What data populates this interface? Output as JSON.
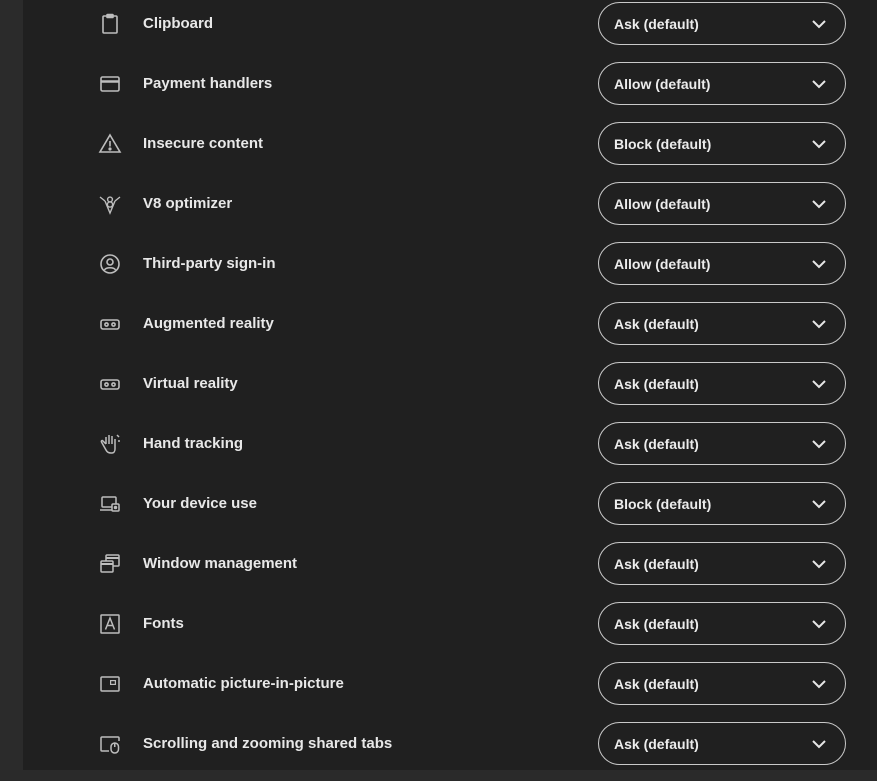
{
  "permissions": [
    {
      "label": "Clipboard",
      "value": "Ask (default)",
      "icon": "clipboard-icon"
    },
    {
      "label": "Payment handlers",
      "value": "Allow (default)",
      "icon": "credit-card-icon"
    },
    {
      "label": "Insecure content",
      "value": "Block (default)",
      "icon": "warning-icon"
    },
    {
      "label": "V8 optimizer",
      "value": "Allow (default)",
      "icon": "v8-icon"
    },
    {
      "label": "Third-party sign-in",
      "value": "Allow (default)",
      "icon": "account-circle-icon"
    },
    {
      "label": "Augmented reality",
      "value": "Ask (default)",
      "icon": "vr-headset-icon"
    },
    {
      "label": "Virtual reality",
      "value": "Ask (default)",
      "icon": "vr-headset-icon"
    },
    {
      "label": "Hand tracking",
      "value": "Ask (default)",
      "icon": "hand-icon"
    },
    {
      "label": "Your device use",
      "value": "Block (default)",
      "icon": "device-use-icon"
    },
    {
      "label": "Window management",
      "value": "Ask (default)",
      "icon": "window-management-icon"
    },
    {
      "label": "Fonts",
      "value": "Ask (default)",
      "icon": "font-icon"
    },
    {
      "label": "Automatic picture-in-picture",
      "value": "Ask (default)",
      "icon": "picture-in-picture-icon"
    },
    {
      "label": "Scrolling and zooming shared tabs",
      "value": "Ask (default)",
      "icon": "shared-tab-scroll-icon"
    }
  ]
}
